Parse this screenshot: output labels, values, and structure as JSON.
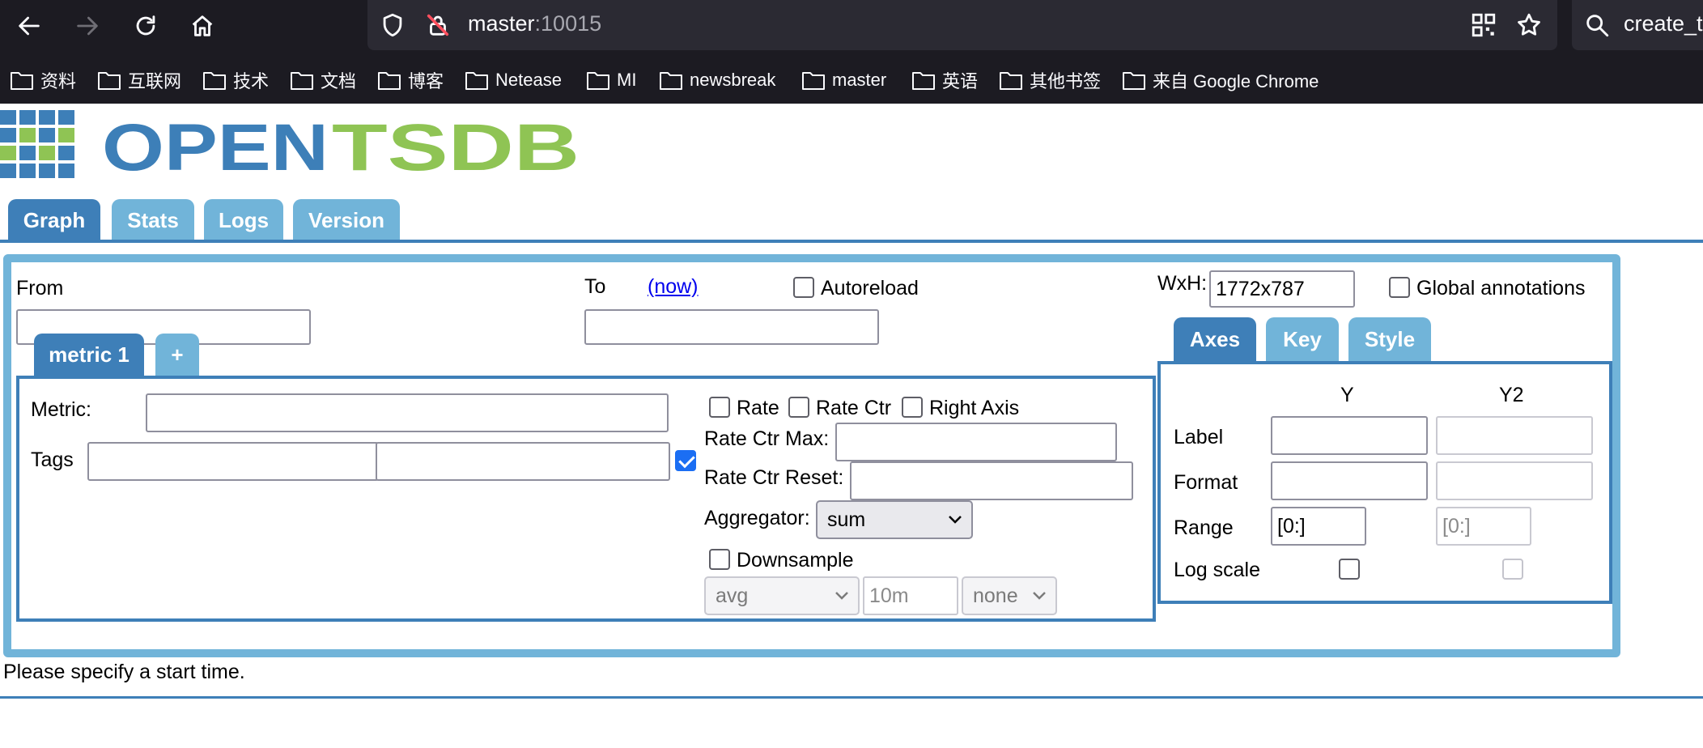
{
  "browser": {
    "url_host": "master",
    "url_port": ":10015",
    "search_text": "create_t",
    "bookmarks": [
      "资料",
      "互联网",
      "技术",
      "文档",
      "博客",
      "Netease",
      "MI",
      "newsbreak",
      "master",
      "英语",
      "其他书签",
      "来自 Google Chrome"
    ]
  },
  "colors": {
    "tab_active": "#3e7fb8",
    "tab_inactive": "#71b4d9",
    "logo_blue": "#3d7fb8",
    "logo_green": "#8fc454",
    "checkbox_checked": "#1b6ef3"
  },
  "logo": {
    "word_left": "OPEN",
    "word_right": "TSDB"
  },
  "nav_tabs": [
    {
      "label": "Graph",
      "active": true
    },
    {
      "label": "Stats",
      "active": false
    },
    {
      "label": "Logs",
      "active": false
    },
    {
      "label": "Version",
      "active": false
    }
  ],
  "form": {
    "from_label": "From",
    "from_value": "",
    "to_label": "To",
    "to_now_link": "(now)",
    "to_value": "",
    "autoreload_label": "Autoreload",
    "autoreload_checked": false,
    "wxh_label": "WxH:",
    "wxh_value": "1772x787",
    "global_annotations_label": "Global annotations",
    "global_annotations_checked": false
  },
  "metric_tabs": [
    {
      "label": "metric 1",
      "active": true
    },
    {
      "label": "+",
      "active": false
    }
  ],
  "metric": {
    "metric_label": "Metric:",
    "metric_value": "",
    "tags_label": "Tags",
    "tag_key": "",
    "tag_value": "",
    "tag_group_checked": true,
    "rate_label": "Rate",
    "rate_ctr_label": "Rate Ctr",
    "right_axis_label": "Right Axis",
    "rate_ctr_max_label": "Rate Ctr Max:",
    "rate_ctr_max_value": "",
    "rate_ctr_reset_label": "Rate Ctr Reset:",
    "rate_ctr_reset_value": "",
    "aggregator_label": "Aggregator:",
    "aggregator_value": "sum",
    "downsample_label": "Downsample",
    "downsample_checked": false,
    "downsample_function": "avg",
    "downsample_interval": "10m",
    "downsample_fill": "none"
  },
  "options_tabs": [
    {
      "label": "Axes",
      "active": true
    },
    {
      "label": "Key",
      "active": false
    },
    {
      "label": "Style",
      "active": false
    }
  ],
  "axes": {
    "y_header": "Y",
    "y2_header": "Y2",
    "label_row": "Label",
    "format_row": "Format",
    "range_row": "Range",
    "log_scale_row": "Log scale",
    "y_range": "[0:]",
    "y2_range": "[0:]",
    "y_log_checked": false,
    "y2_log_checked": false
  },
  "status_message": "Please specify a start time."
}
